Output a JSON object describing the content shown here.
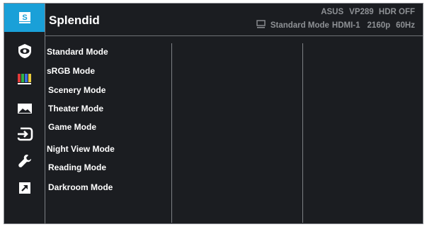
{
  "header": {
    "title": "Splendid",
    "brand": "ASUS",
    "model": "VP289",
    "hdr_status": "HDR OFF",
    "mode": "Standard Mode",
    "input": "HDMI-1",
    "resolution": "2160p",
    "refresh": "60Hz"
  },
  "sidebar": {
    "items": [
      {
        "icon": "splendid-icon",
        "selected": true
      },
      {
        "icon": "eye-care-icon"
      },
      {
        "icon": "color-bars-icon"
      },
      {
        "icon": "image-icon"
      },
      {
        "icon": "input-select-icon"
      },
      {
        "icon": "wrench-icon"
      },
      {
        "icon": "shortcut-icon"
      }
    ],
    "selected_badge": "S"
  },
  "menu": {
    "items": [
      "Standard Mode",
      "sRGB Mode",
      "Scenery Mode",
      "Theater Mode",
      "Game Mode",
      "Night View Mode",
      "Reading Mode",
      "Darkroom Mode"
    ]
  },
  "colors": {
    "background": "#1b1d21",
    "accent": "#1aa0d8",
    "text": "#ffffff",
    "muted_text": "#8e9195"
  }
}
